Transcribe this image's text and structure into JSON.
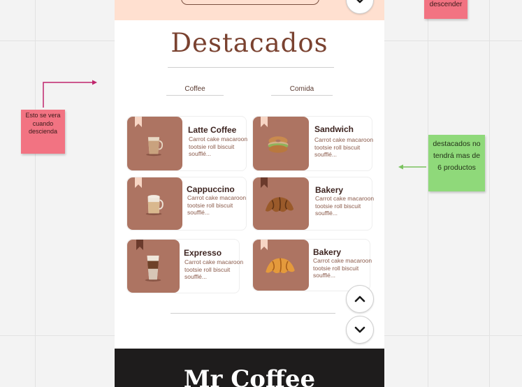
{
  "page": {
    "title": "Destacados",
    "tabs": [
      {
        "label": "Coffee"
      },
      {
        "label": "Comida"
      }
    ],
    "footer_title": "Mr Coffee",
    "products": [
      {
        "name": "Latte Coffee",
        "desc": "Carrot cake macaroon tootsie roll biscuit soufflé...",
        "icon": "latte-icon",
        "bookmark": "light"
      },
      {
        "name": "Sandwich",
        "desc": "Carrot cake macaroon tootsie roll biscuit soufflé...",
        "icon": "bagel-sandwich-icon",
        "bookmark": "light"
      },
      {
        "name": "Cappuccino",
        "desc": "Carrot cake macaroon tootsie roll biscuit soufflé...",
        "icon": "cappuccino-icon",
        "bookmark": "light"
      },
      {
        "name": "Bakery",
        "desc": "Carrot cake macaroon tootsie roll biscuit soufflé...",
        "icon": "croissant-icon",
        "bookmark": "dark"
      },
      {
        "name": "Expresso",
        "desc": "Carrot cake macaroon tootsie roll biscuit soufflé...",
        "icon": "iced-coffee-icon",
        "bookmark": "dark"
      },
      {
        "name": "Bakery",
        "desc": "Carrot cake macaroon tootsie roll biscuit soufflé...",
        "icon": "croissant-icon",
        "bookmark": "light"
      }
    ]
  },
  "notes": {
    "descender": "descender",
    "scroll_note": "Esto se vera cuando descienda",
    "max_note": "destacados no tendrá mas de 6 productos"
  },
  "colors": {
    "brand_brown": "#7a4230",
    "thumb_bg": "#ad7462",
    "top_band": "#ffe0d0",
    "footer_bg": "#1e1c1c",
    "note_pink": "#f27382",
    "note_green": "#8fd97a"
  }
}
